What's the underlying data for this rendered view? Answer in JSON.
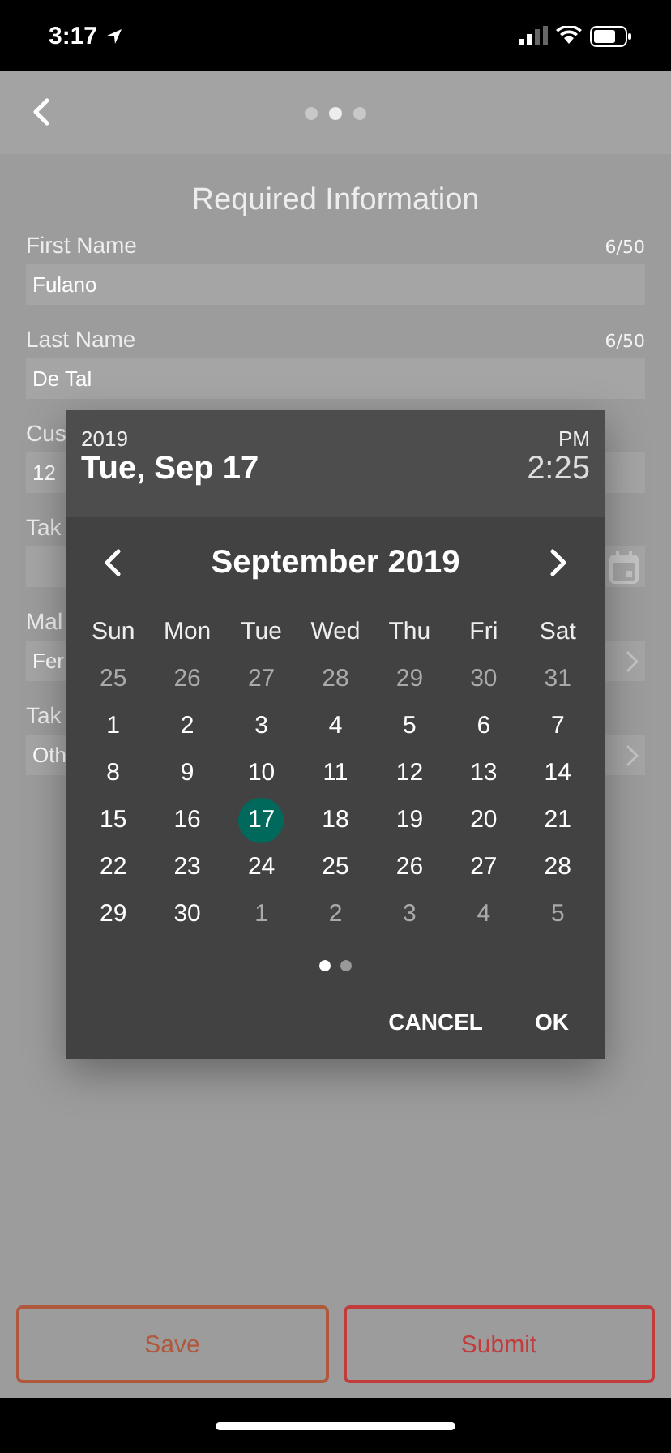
{
  "status_bar": {
    "time": "3:17"
  },
  "nav": {
    "pages": [
      {
        "selected": false
      },
      {
        "selected": true
      },
      {
        "selected": false
      }
    ]
  },
  "title": "Required Information",
  "fields": [
    {
      "kind": "text",
      "label": "First Name",
      "counter": "6/50",
      "value": "Fulano"
    },
    {
      "kind": "text",
      "label": "Last Name",
      "counter": "6/50",
      "value": "De Tal"
    },
    {
      "kind": "text",
      "label": "Cus",
      "value": "12"
    },
    {
      "kind": "date",
      "label": "Tak"
    },
    {
      "kind": "select",
      "label": "Mal",
      "value": "Fer"
    },
    {
      "kind": "select",
      "label": "Tak",
      "value": "Oth"
    }
  ],
  "date_picker": {
    "year": "2019",
    "date": "Tue, Sep 17",
    "ampm": "PM",
    "time": "2:25",
    "month": "September 2019",
    "weekdays": [
      "Sun",
      "Mon",
      "Tue",
      "Wed",
      "Thu",
      "Fri",
      "Sat"
    ],
    "weeks": [
      [
        {
          "day": "25",
          "in_month": false,
          "selected": false
        },
        {
          "day": "26",
          "in_month": false,
          "selected": false
        },
        {
          "day": "27",
          "in_month": false,
          "selected": false
        },
        {
          "day": "28",
          "in_month": false,
          "selected": false
        },
        {
          "day": "29",
          "in_month": false,
          "selected": false
        },
        {
          "day": "30",
          "in_month": false,
          "selected": false
        },
        {
          "day": "31",
          "in_month": false,
          "selected": false
        }
      ],
      [
        {
          "day": "1",
          "in_month": true,
          "selected": false
        },
        {
          "day": "2",
          "in_month": true,
          "selected": false
        },
        {
          "day": "3",
          "in_month": true,
          "selected": false
        },
        {
          "day": "4",
          "in_month": true,
          "selected": false
        },
        {
          "day": "5",
          "in_month": true,
          "selected": false
        },
        {
          "day": "6",
          "in_month": true,
          "selected": false
        },
        {
          "day": "7",
          "in_month": true,
          "selected": false
        }
      ],
      [
        {
          "day": "8",
          "in_month": true,
          "selected": false
        },
        {
          "day": "9",
          "in_month": true,
          "selected": false
        },
        {
          "day": "10",
          "in_month": true,
          "selected": false
        },
        {
          "day": "11",
          "in_month": true,
          "selected": false
        },
        {
          "day": "12",
          "in_month": true,
          "selected": false
        },
        {
          "day": "13",
          "in_month": true,
          "selected": false
        },
        {
          "day": "14",
          "in_month": true,
          "selected": false
        }
      ],
      [
        {
          "day": "15",
          "in_month": true,
          "selected": false
        },
        {
          "day": "16",
          "in_month": true,
          "selected": false
        },
        {
          "day": "17",
          "in_month": true,
          "selected": true
        },
        {
          "day": "18",
          "in_month": true,
          "selected": false
        },
        {
          "day": "19",
          "in_month": true,
          "selected": false
        },
        {
          "day": "20",
          "in_month": true,
          "selected": false
        },
        {
          "day": "21",
          "in_month": true,
          "selected": false
        }
      ],
      [
        {
          "day": "22",
          "in_month": true,
          "selected": false
        },
        {
          "day": "23",
          "in_month": true,
          "selected": false
        },
        {
          "day": "24",
          "in_month": true,
          "selected": false
        },
        {
          "day": "25",
          "in_month": true,
          "selected": false
        },
        {
          "day": "26",
          "in_month": true,
          "selected": false
        },
        {
          "day": "27",
          "in_month": true,
          "selected": false
        },
        {
          "day": "28",
          "in_month": true,
          "selected": false
        }
      ],
      [
        {
          "day": "29",
          "in_month": true,
          "selected": false
        },
        {
          "day": "30",
          "in_month": true,
          "selected": false
        },
        {
          "day": "1",
          "in_month": false,
          "selected": false
        },
        {
          "day": "2",
          "in_month": false,
          "selected": false
        },
        {
          "day": "3",
          "in_month": false,
          "selected": false
        },
        {
          "day": "4",
          "in_month": false,
          "selected": false
        },
        {
          "day": "5",
          "in_month": false,
          "selected": false
        }
      ]
    ],
    "pages": [
      {
        "selected": true
      },
      {
        "selected": false
      }
    ],
    "actions": [
      "CANCEL",
      "OK"
    ]
  },
  "buttons": [
    {
      "label": "Save",
      "color": "#b0583c"
    },
    {
      "label": "Submit",
      "color": "#c23c3c"
    }
  ]
}
